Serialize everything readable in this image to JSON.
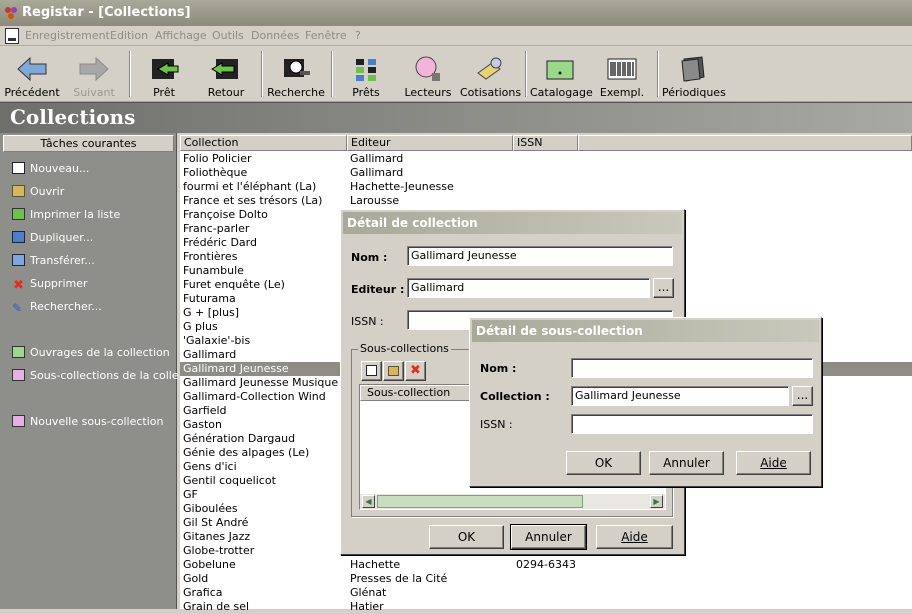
{
  "app": {
    "title": "Registar - [Collections]"
  },
  "menu": [
    "Enregistrement",
    "Edition",
    "Affichage",
    "Outils",
    "Données",
    "Fenêtre",
    "?"
  ],
  "toolbar": [
    {
      "label": "Précédent",
      "icon": "arrow-left-icon",
      "enabled": true
    },
    {
      "label": "Suivant",
      "icon": "arrow-right-icon",
      "enabled": false
    },
    {
      "label": "Prêt",
      "icon": "loan-icon",
      "enabled": true
    },
    {
      "label": "Retour",
      "icon": "return-icon",
      "enabled": true
    },
    {
      "label": "Recherche",
      "icon": "search-icon",
      "enabled": true
    },
    {
      "label": "Prêts",
      "icon": "loans-list-icon",
      "enabled": true
    },
    {
      "label": "Lecteurs",
      "icon": "readers-icon",
      "enabled": true
    },
    {
      "label": "Cotisations",
      "icon": "subscriptions-icon",
      "enabled": true
    },
    {
      "label": "Catalogage",
      "icon": "cataloguing-icon",
      "enabled": true
    },
    {
      "label": "Exempl.",
      "icon": "barcode-icon",
      "enabled": true
    },
    {
      "label": "Périodiques",
      "icon": "periodicals-icon",
      "enabled": true
    }
  ],
  "page": {
    "title": "Collections"
  },
  "sidebar": {
    "header": "Tâches courantes",
    "tasks": [
      "Nouveau...",
      "Ouvrir",
      "Imprimer la liste",
      "Dupliquer...",
      "Transférer...",
      "Supprimer",
      "Rechercher..."
    ],
    "links": [
      "Ouvrages de la collection",
      "Sous-collections de la colle...",
      "Nouvelle sous-collection"
    ]
  },
  "grid": {
    "columns": [
      "Collection",
      "Editeur",
      "ISSN"
    ],
    "rows": [
      [
        "Folio Policier",
        "Gallimard",
        ""
      ],
      [
        "Foliothèque",
        "Gallimard",
        ""
      ],
      [
        "fourmi et l'éléphant (La)",
        "Hachette-Jeunesse",
        ""
      ],
      [
        "France et ses trésors (La)",
        "Larousse",
        ""
      ],
      [
        "Françoise Dolto",
        "",
        ""
      ],
      [
        "Franc-parler",
        "",
        ""
      ],
      [
        "Frédéric Dard",
        "",
        ""
      ],
      [
        "Frontières",
        "",
        ""
      ],
      [
        "Funambule",
        "",
        ""
      ],
      [
        "Furet enquête (Le)",
        "",
        ""
      ],
      [
        "Futurama",
        "",
        ""
      ],
      [
        "G + [plus]",
        "",
        ""
      ],
      [
        "G plus",
        "",
        ""
      ],
      [
        "'Galaxie'-bis",
        "",
        ""
      ],
      [
        "Gallimard",
        "",
        ""
      ],
      [
        "Gallimard Jeunesse",
        "",
        ""
      ],
      [
        "Gallimard Jeunesse Musique",
        "",
        ""
      ],
      [
        "Gallimard-Collection Wind",
        "",
        ""
      ],
      [
        "Garfield",
        "",
        ""
      ],
      [
        "Gaston",
        "",
        ""
      ],
      [
        "Génération Dargaud",
        "",
        ""
      ],
      [
        "Génie des alpages (Le)",
        "",
        ""
      ],
      [
        "Gens d'ici",
        "",
        ""
      ],
      [
        "Gentil coquelicot",
        "",
        ""
      ],
      [
        "GF",
        "",
        ""
      ],
      [
        "Giboulées",
        "",
        ""
      ],
      [
        "Gil St André",
        "",
        ""
      ],
      [
        "Gitanes Jazz",
        "",
        ""
      ],
      [
        "Globe-trotter",
        "",
        ""
      ],
      [
        "Gobelune",
        "Hachette",
        "0294-6343"
      ],
      [
        "Gold",
        "Presses de la Cité",
        ""
      ],
      [
        "Grafica",
        "Glénat",
        ""
      ],
      [
        "Grain de sel",
        "Hatier",
        ""
      ]
    ],
    "selected_index": 15
  },
  "dialog1": {
    "title": "Détail de collection",
    "nom_label": "Nom :",
    "nom_value": "Gallimard Jeunesse",
    "editeur_label": "Editeur :",
    "editeur_value": "Gallimard",
    "issn_label": "ISSN :",
    "issn_value": "",
    "browse": "...",
    "group_label": "Sous-collections",
    "list_header": "Sous-collection",
    "ok": "OK",
    "cancel": "Annuler",
    "help": "Aide"
  },
  "dialog2": {
    "title": "Détail de sous-collection",
    "nom_label": "Nom :",
    "nom_value": "",
    "collection_label": "Collection :",
    "collection_value": "Gallimard Jeunesse",
    "issn_label": "ISSN :",
    "issn_value": "",
    "browse": "...",
    "ok": "OK",
    "cancel": "Annuler",
    "help": "Aide"
  }
}
